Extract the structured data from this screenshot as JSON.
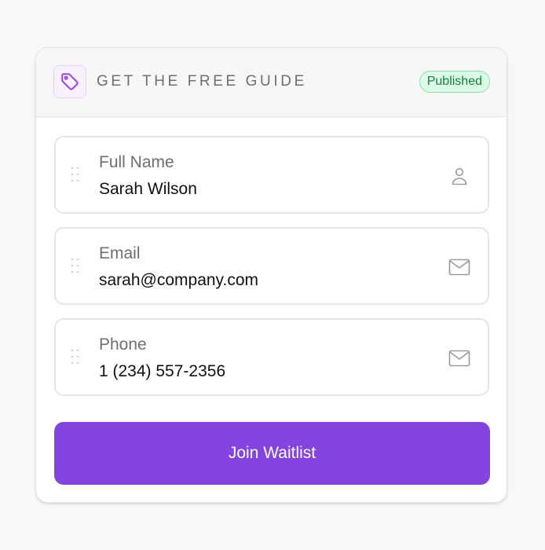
{
  "header": {
    "icon": "tag-icon",
    "title": "GET THE FREE GUIDE",
    "status": "Published"
  },
  "fields": [
    {
      "label": "Full Name",
      "value": "Sarah Wilson",
      "icon": "user-icon"
    },
    {
      "label": "Email",
      "value": "sarah@company.com",
      "icon": "mail-icon"
    },
    {
      "label": "Phone",
      "value": "1 (234) 557-2356",
      "icon": "mail-icon"
    }
  ],
  "submit": {
    "label": "Join Waitlist"
  },
  "colors": {
    "accent": "#8444e0",
    "badge_bg": "#dcfce7",
    "badge_text": "#15803d"
  }
}
